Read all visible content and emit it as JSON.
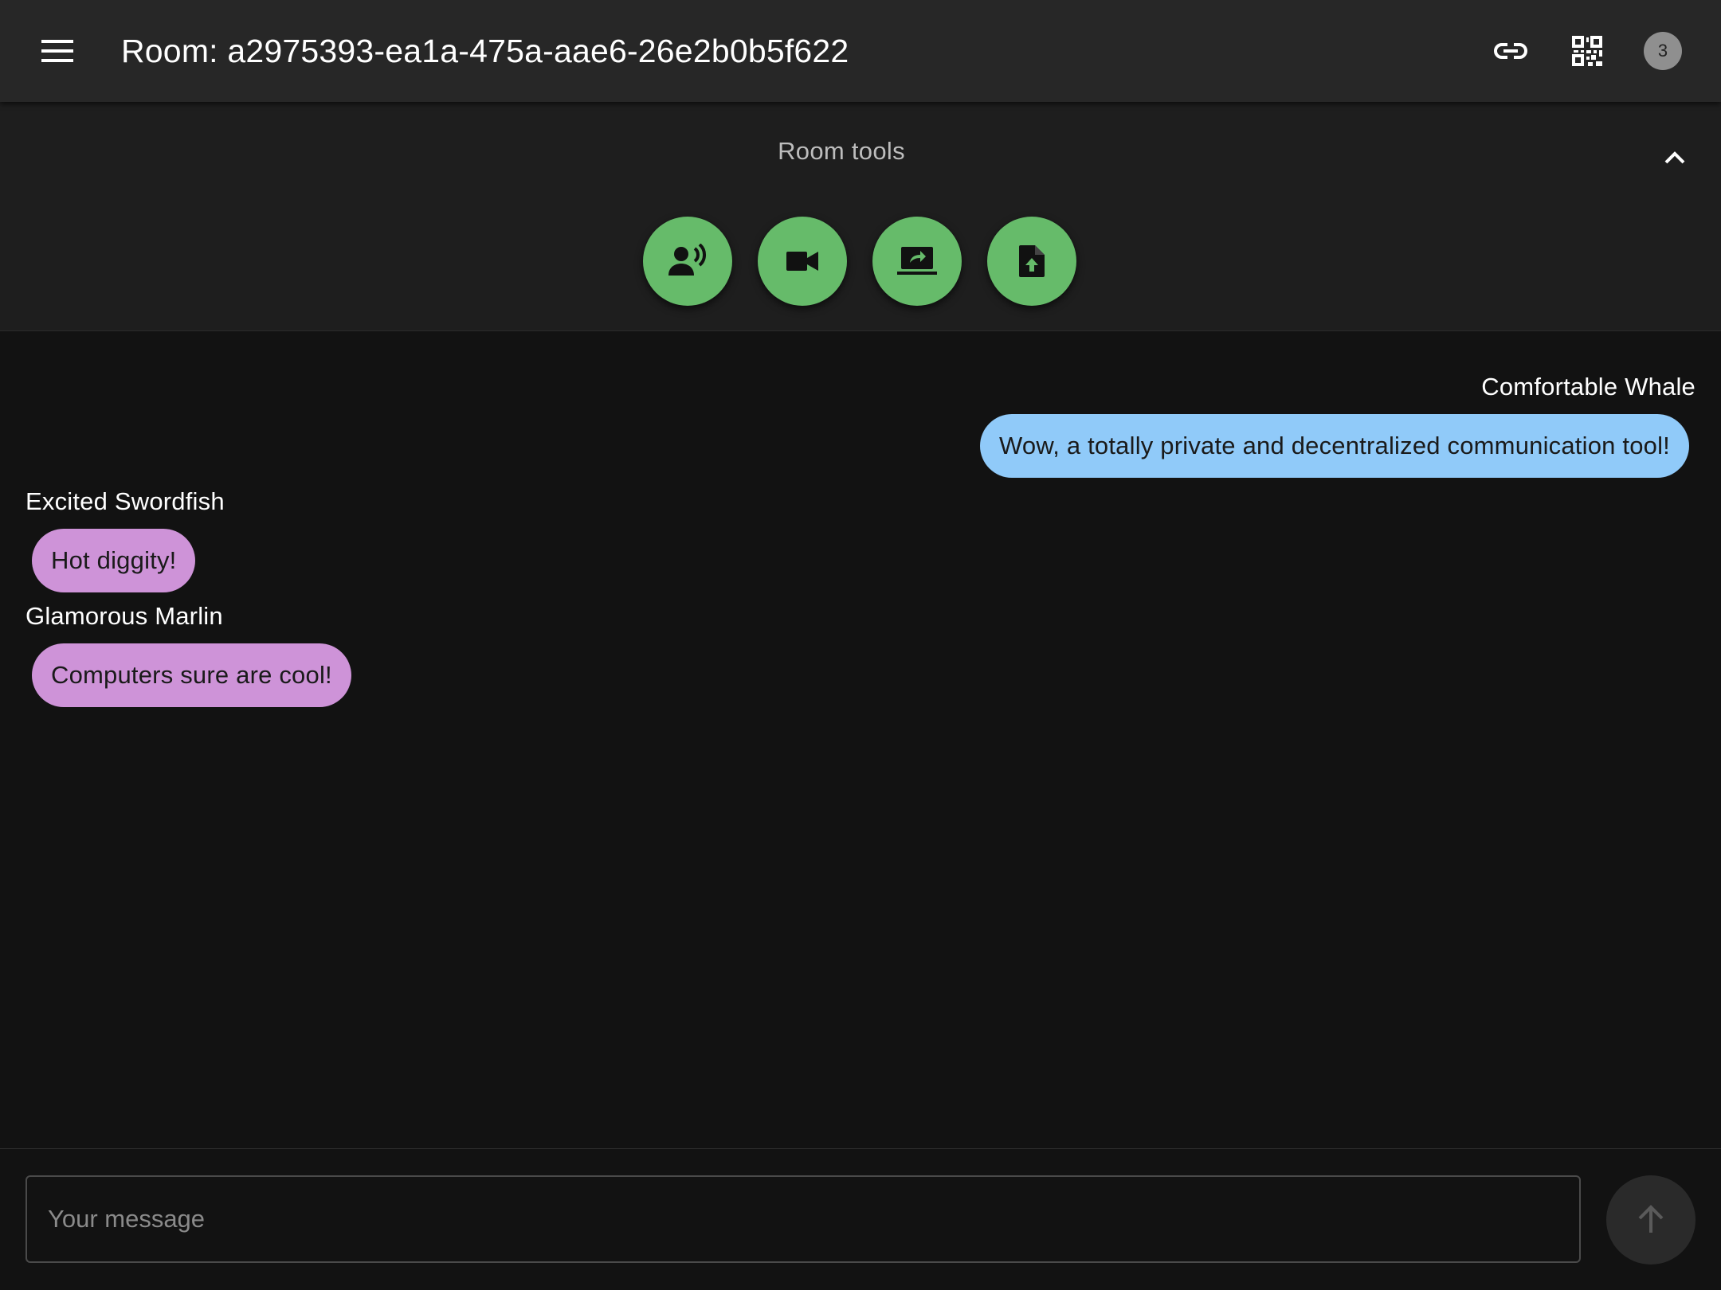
{
  "header": {
    "title": "Room: a2975393-ea1a-475a-aae6-26e2b0b5f622",
    "menu_icon": "menu-icon",
    "link_icon": "link-icon",
    "qr_icon": "qr-code-icon",
    "peer_count": "3"
  },
  "room_tools": {
    "title": "Room tools",
    "collapse_icon": "chevron-up-icon",
    "buttons": [
      {
        "icon": "voice-call-icon"
      },
      {
        "icon": "video-call-icon"
      },
      {
        "icon": "screen-share-icon"
      },
      {
        "icon": "file-upload-icon"
      }
    ],
    "accent_color": "#66bb6a"
  },
  "messages": [
    {
      "author": "Comfortable Whale",
      "text": "Wow, a totally private and decentralized communication tool!",
      "own": true,
      "color": "#90caf9"
    },
    {
      "author": "Excited Swordfish",
      "text": "Hot diggity!",
      "own": false,
      "color": "#ce93d8"
    },
    {
      "author": "Glamorous Marlin",
      "text": "Computers sure are cool!",
      "own": false,
      "color": "#ce93d8"
    }
  ],
  "composer": {
    "placeholder": "Your message",
    "value": "",
    "send_icon": "arrow-up-icon"
  }
}
